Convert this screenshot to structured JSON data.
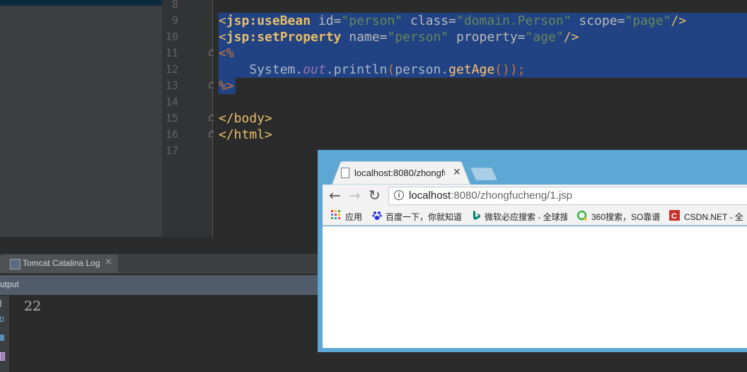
{
  "editor": {
    "line_numbers": [
      "8",
      "9",
      "10",
      "11",
      "12",
      "13",
      "14",
      "15",
      "16",
      "17"
    ],
    "lines": {
      "l9": {
        "open": "<",
        "tag": "jsp:useBean",
        "a1": " id=",
        "v1": "\"person\"",
        "a2": " class=",
        "v2": "\"domain.Person\"",
        "a3": " scope=",
        "v3": "\"page\"",
        "close": "/>"
      },
      "l10": {
        "open": "<",
        "tag": "jsp:setProperty",
        "a1": " name=",
        "v1": "\"person\"",
        "a2": " property=",
        "v2": "\"age\"",
        "close": "/>"
      },
      "l11": "<%",
      "l12": {
        "indent": "    ",
        "obj": "System.",
        "field": "out",
        "dot": ".",
        "method": "println",
        "p1": "(",
        "arg": "person.",
        "getter": "getAge",
        "p2": "());"
      },
      "l13": "%>",
      "l15": "</body>",
      "l16": "</html>"
    }
  },
  "tool_window": {
    "tab_label": "Tomcat Catalina Log",
    "tab_close": "×",
    "output_header": "utput",
    "output_value": "22"
  },
  "browser": {
    "tab_title": "localhost:8080/zhongfu",
    "tab_close": "×",
    "url_host": "localhost",
    "url_rest": ":8080/zhongfucheng/1.jsp",
    "nav": {
      "back": "←",
      "forward": "→",
      "reload": "↻"
    },
    "bookmarks": [
      "应用",
      "百度一下，你就知道",
      "微软必应搜索 - 全球搜",
      "360搜索，SO靠谱",
      "CSDN.NET - 全"
    ]
  },
  "colors": {
    "selection": "#214283",
    "browser_frame": "#5ca7d3",
    "ide_bg": "#2b2b2b"
  }
}
